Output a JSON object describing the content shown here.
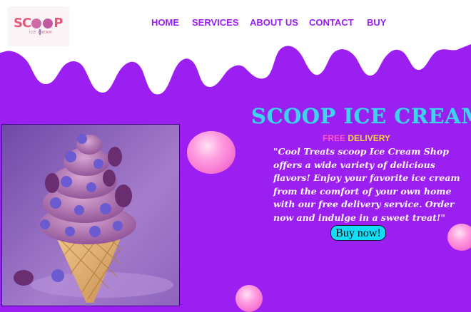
{
  "logo": {
    "main_text": "SC",
    "main_text_end": "P",
    "sub_text": "ICE CREAM"
  },
  "nav": {
    "items": [
      "HOME",
      "SERVICES",
      "ABOUT US",
      "CONTACT",
      "BUY"
    ]
  },
  "hero": {
    "title": "SCOOP ICE CREAM",
    "badge_free": "FREE",
    "badge_delivery": "DELIVERY",
    "description": "\"Cool Treats scoop Ice Cream Shop offers a wide variety of delicious flavors! Enjoy your favorite ice cream from the comfort of your own home with our free delivery service. Order now and indulge in a sweet treat!\"",
    "cta_label": "Buy now!"
  },
  "colors": {
    "background": "#9b1ff0",
    "nav_text": "#9b1ff0",
    "title": "#3fd3f0",
    "cta": "#14dcf6",
    "free": "#ff55c6",
    "delivery": "#f6d23b"
  }
}
